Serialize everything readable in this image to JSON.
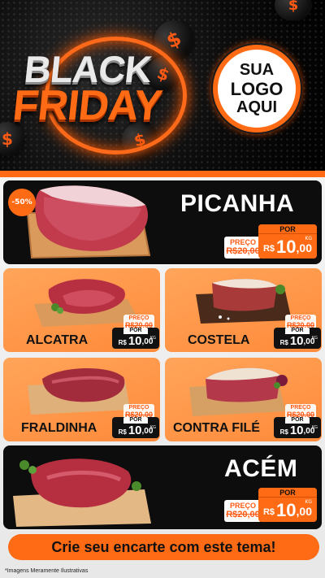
{
  "header": {
    "title_line1": "BLACK",
    "title_line2": "FRIDAY",
    "logo_lines": [
      "SUA",
      "LOGO",
      "AQUI"
    ],
    "coin_symbol": "$"
  },
  "colors": {
    "accent": "#ff6a14",
    "dark_card": "#0d0d0d",
    "orange_card": "#ff9a4a"
  },
  "products": [
    {
      "name": "PICANHA",
      "badge": "-50%",
      "was_label": "PREÇO",
      "was_price": "R$20,00",
      "now_label": "POR",
      "currency": "R$",
      "price_int": "10",
      "price_dec": ",00",
      "unit": "KG"
    },
    {
      "name": "ALCATRA",
      "was_label": "PREÇO",
      "was_price": "R$20,00",
      "now_label": "POR",
      "currency": "R$",
      "price_int": "10",
      "price_dec": ",00",
      "unit": "KG"
    },
    {
      "name": "COSTELA",
      "was_label": "PREÇO",
      "was_price": "R$20,00",
      "now_label": "POR",
      "currency": "R$",
      "price_int": "10",
      "price_dec": ",00",
      "unit": "KG"
    },
    {
      "name": "FRALDINHA",
      "was_label": "PREÇO",
      "was_price": "R$20,00",
      "now_label": "POR",
      "currency": "R$",
      "price_int": "10",
      "price_dec": ",00",
      "unit": "KG"
    },
    {
      "name": "CONTRA FILÉ",
      "was_label": "PREÇO",
      "was_price": "R$20,00",
      "now_label": "POR",
      "currency": "R$",
      "price_int": "10",
      "price_dec": ",00",
      "unit": "KG"
    },
    {
      "name": "ACÉM",
      "was_label": "PREÇO",
      "was_price": "R$20,00",
      "now_label": "POR",
      "currency": "R$",
      "price_int": "10",
      "price_dec": ",00",
      "unit": "KG"
    }
  ],
  "cta": "Crie seu encarte com este tema!",
  "disclaimer": "*Imagens Meramente Ilustrativas"
}
